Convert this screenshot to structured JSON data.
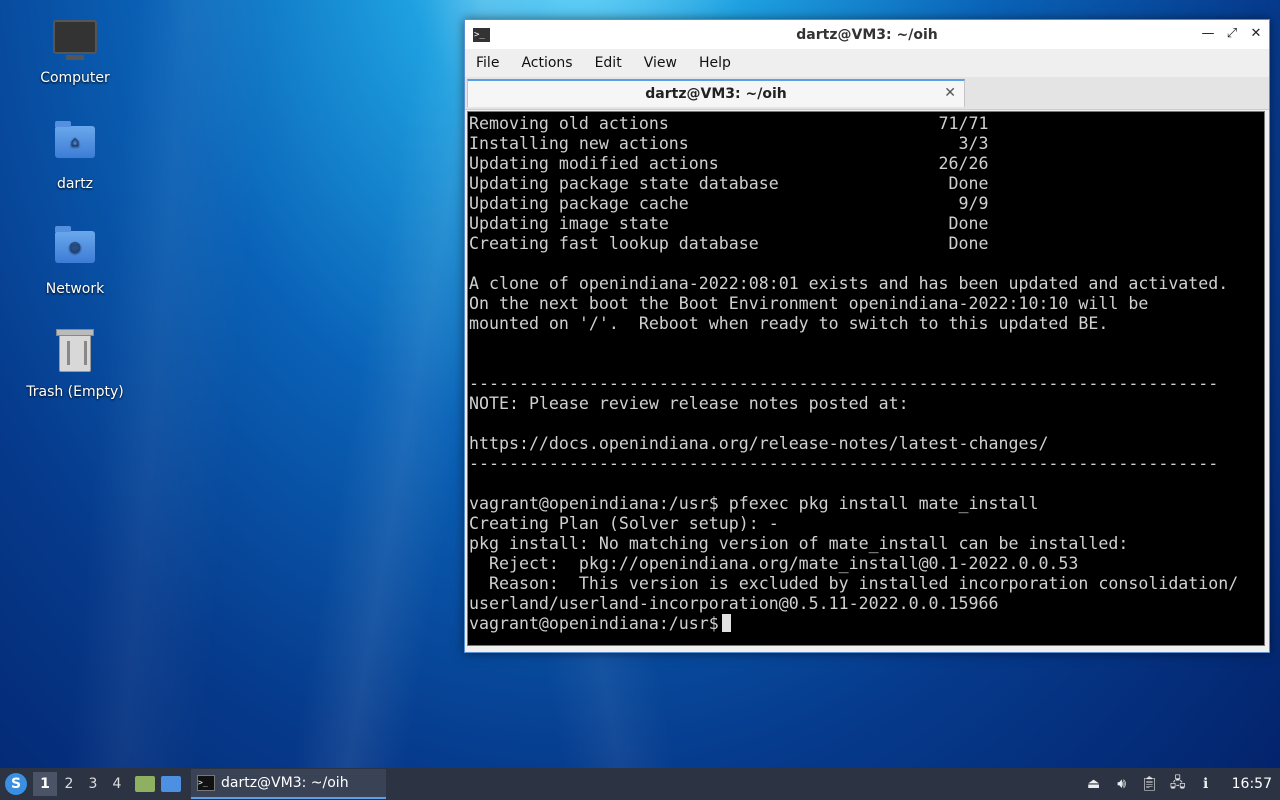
{
  "desktop": {
    "icons": [
      {
        "label": "Computer"
      },
      {
        "label": "dartz"
      },
      {
        "label": "Network"
      },
      {
        "label": "Trash (Empty)"
      }
    ]
  },
  "window": {
    "title": "dartz@VM3: ~/oih",
    "menu": [
      "File",
      "Actions",
      "Edit",
      "View",
      "Help"
    ],
    "tab_label": "dartz@VM3: ~/oih",
    "terminal_lines": [
      "Removing old actions                           71/71",
      "Installing new actions                           3/3",
      "Updating modified actions                      26/26",
      "Updating package state database                 Done",
      "Updating package cache                           9/9",
      "Updating image state                            Done",
      "Creating fast lookup database                   Done",
      "",
      "A clone of openindiana-2022:08:01 exists and has been updated and activated.",
      "On the next boot the Boot Environment openindiana-2022:10:10 will be",
      "mounted on '/'.  Reboot when ready to switch to this updated BE.",
      "",
      "",
      "---------------------------------------------------------------------------",
      "NOTE: Please review release notes posted at:",
      "",
      "https://docs.openindiana.org/release-notes/latest-changes/",
      "---------------------------------------------------------------------------",
      "",
      "vagrant@openindiana:/usr$ pfexec pkg install mate_install",
      "Creating Plan (Solver setup): -",
      "pkg install: No matching version of mate_install can be installed:",
      "  Reject:  pkg://openindiana.org/mate_install@0.1-2022.0.0.53",
      "  Reason:  This version is excluded by installed incorporation consolidation/",
      "userland/userland-incorporation@0.5.11-2022.0.0.15966"
    ],
    "prompt": "vagrant@openindiana:/usr$"
  },
  "taskbar": {
    "workspaces": [
      "1",
      "2",
      "3",
      "4"
    ],
    "task_label": "dartz@VM3: ~/oih",
    "clock": "16:57"
  },
  "colors": {
    "accent": "#5aa0e8",
    "terminal_bg": "#000000",
    "terminal_fg": "#d0d0d0",
    "taskbar_bg": "#2c3444"
  }
}
